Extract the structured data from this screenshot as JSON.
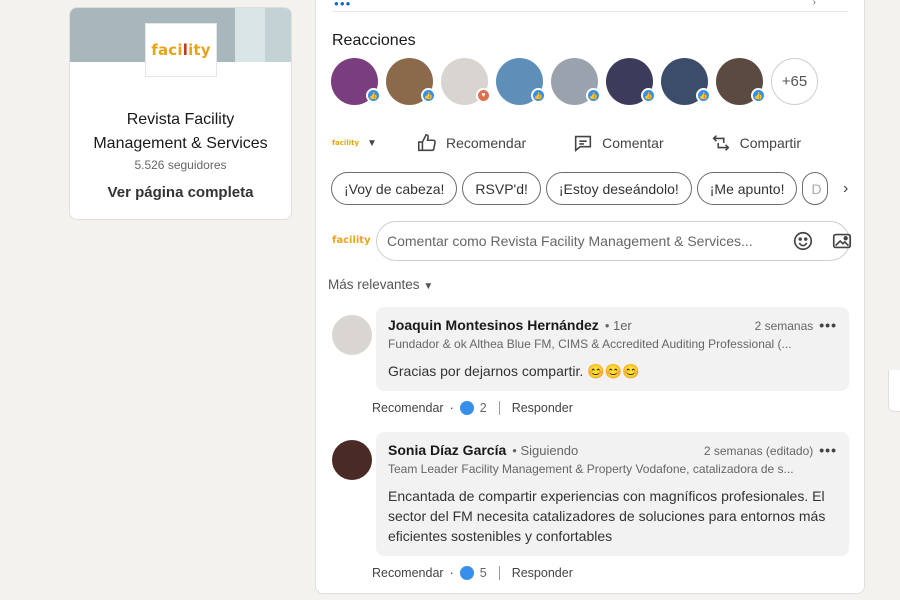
{
  "company": {
    "logo_text_a": "faci",
    "logo_text_b": "l",
    "logo_text_c": "ity",
    "name": "Revista Facility Management & Services",
    "followers": "5.526 seguidores",
    "link": "Ver página completa"
  },
  "reactions": {
    "title": "Reacciones",
    "more": "+65",
    "avatars": [
      {
        "bg": "#7a3d7e",
        "react": "like"
      },
      {
        "bg": "#8a6a4b",
        "react": "like"
      },
      {
        "bg": "#d8d5d0",
        "react": "love"
      },
      {
        "bg": "#5d8fb8",
        "react": "like"
      },
      {
        "bg": "#9aa3ad",
        "react": "like"
      },
      {
        "bg": "#3d3b5c",
        "react": "like"
      },
      {
        "bg": "#3b4d6b",
        "react": "like"
      },
      {
        "bg": "#5b4a3f",
        "react": "like"
      }
    ]
  },
  "actions": {
    "actor_logo": "facility",
    "recommend": "Recomendar",
    "comment": "Comentar",
    "share": "Compartir"
  },
  "chips": [
    "¡Voy de cabeza!",
    "RSVP'd!",
    "¡Estoy deseándolo!",
    "¡Me apunto!",
    "D"
  ],
  "comment_box": {
    "logo": "facility",
    "placeholder": "Comentar como Revista Facility Management & Services..."
  },
  "sort_label": "Más relevantes",
  "comments": [
    {
      "name": "Joaquin Montesinos Hernández",
      "degree": "• 1er",
      "time": "2 semanas",
      "title": "Fundador & ok Althea Blue FM, CIMS & Accredited Auditing Professional (...",
      "text": "Gracias por dejarnos compartir. 😊😊😊",
      "recommend": "Recomendar",
      "likes": "2",
      "reply": "Responder",
      "avatar_bg": "#d9d6d2"
    },
    {
      "name": "Sonia Díaz García",
      "degree": "• Siguiendo",
      "time": "2 semanas (editado)",
      "title": "Team Leader Facility Management & Property Vodafone, catalizadora de s...",
      "text": "Encantada de compartir experiencias con magníficos profesionales. El sector del FM necesita catalizadores de soluciones para entornos más eficientes sostenibles y confortables",
      "recommend": "Recomendar",
      "likes": "5",
      "reply": "Responder",
      "avatar_bg": "#4a2a24"
    }
  ],
  "colors": {
    "accent": "#0a66c2",
    "like": "#378fe9",
    "love": "#df704d",
    "brand_orange": "#e8a317"
  }
}
